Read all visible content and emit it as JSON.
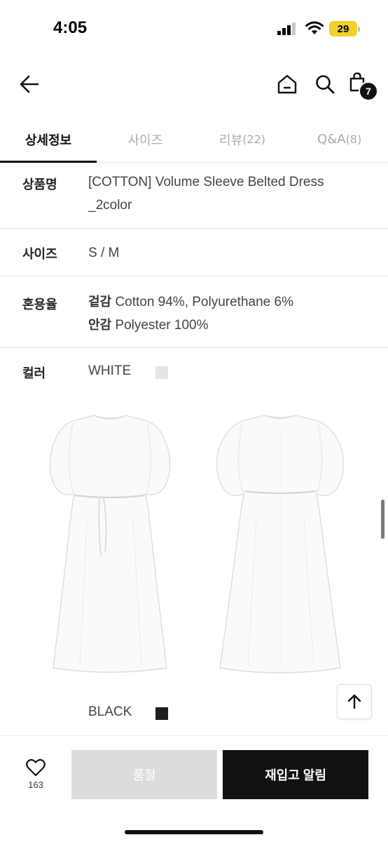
{
  "status_bar": {
    "time": "4:05",
    "battery": "29"
  },
  "header": {
    "cart_count": "7"
  },
  "tabs": [
    {
      "label": "상세정보",
      "count": ""
    },
    {
      "label": "사이즈",
      "count": ""
    },
    {
      "label": "리뷰",
      "count": "(22)"
    },
    {
      "label": "Q&A",
      "count": "(8)"
    }
  ],
  "info": {
    "product_name_label": "상품명",
    "product_name_line1": "[COTTON] Volume Sleeve Belted Dress",
    "product_name_line2": "_2color",
    "size_label": "사이즈",
    "size_value": "S / M",
    "material_label": "혼용율",
    "outer_label": "겉감",
    "outer_value": "Cotton 94%, Polyurethane 6%",
    "inner_label": "안감",
    "inner_value": "Polyester 100%",
    "color_label": "컬러"
  },
  "colors": [
    {
      "name": "WHITE",
      "hex": "#e4e4e4"
    },
    {
      "name": "BLACK",
      "hex": "#1d1d1d"
    }
  ],
  "bottom_bar": {
    "like_count": "163",
    "soldout_label": "품절",
    "restock_label": "재입고 알림"
  }
}
